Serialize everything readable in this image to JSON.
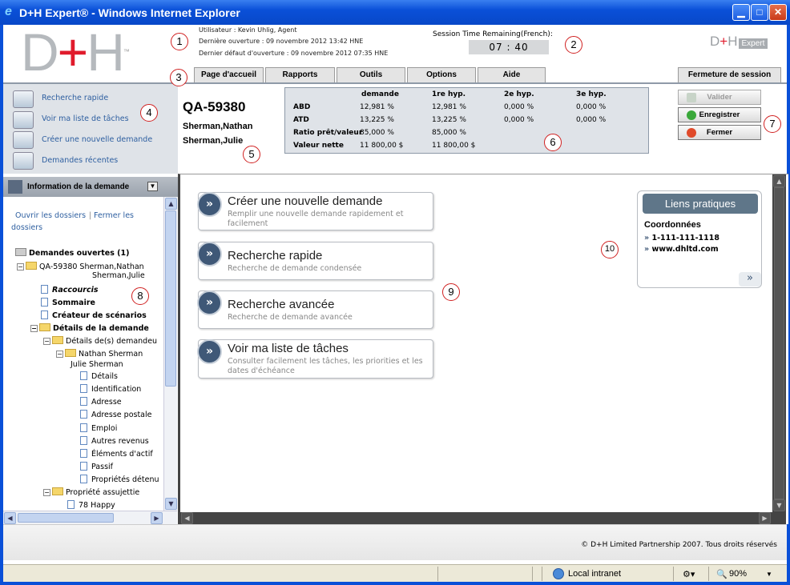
{
  "window": {
    "title": "D+H Expert® - Windows Internet Explorer"
  },
  "header": {
    "logo_d": "D",
    "logo_plus": "+",
    "logo_h": "H",
    "logo_tm": "™",
    "user_line": "Utilisateur : Kevin Uhlig, Agent",
    "last_open_line": "Dernière ouverture : 09 novembre 2012 13:42 HNE",
    "last_fail_line": "Dernier défaut d'ouverture : 09 novembre 2012 07:35 HNE",
    "session_label": "Session Time Remaining(French):",
    "session_time": "07 : 40",
    "logo2_text": "D+H",
    "logo2_badge": "Expert"
  },
  "nav": {
    "tabs": [
      "Page d'accueil",
      "Rapports",
      "Outils",
      "Options",
      "Aide"
    ],
    "logout": "Fermeture de session"
  },
  "quick_links": [
    "Recherche rapide",
    "Voir ma liste de tâches",
    "Créer une nouvelle demande",
    "Demandes récentes"
  ],
  "section_header": "Information de la demande",
  "tree": {
    "open_label": "Ouvrir les dossiers",
    "close_label": "Fermer les",
    "close_label2": "dossiers",
    "open_requests": "Demandes ouvertes (1)",
    "request_line1": "QA-59380 Sherman,Nathan",
    "request_line2": "Sherman,Julie",
    "raccourcis": "Raccourcis",
    "sommaire": "Sommaire",
    "createur": "Créateur de scénarios",
    "details_demande": "Détails de la demande",
    "details_demandeur": "Détails de(s) demandeu",
    "nathan": "Nathan Sherman",
    "julie": "Julie Sherman",
    "leaves": [
      "Détails",
      "Identification",
      "Adresse",
      "Adresse postale",
      "Emploi",
      "Autres revenus",
      "Éléments d'actif",
      "Passif",
      "Propriétés détenu"
    ],
    "propriete": "Propriété assujettie",
    "happy": "78 Happy"
  },
  "request": {
    "id": "QA-59380",
    "applicant1": "Sherman,Nathan",
    "applicant2": "Sherman,Julie"
  },
  "ratios": {
    "headers": [
      "demande",
      "1re hyp.",
      "2e hyp.",
      "3e hyp."
    ],
    "rows": [
      {
        "label": "ABD",
        "values": [
          "12,981 %",
          "12,981 %",
          "0,000 %",
          "0,000 %"
        ]
      },
      {
        "label": "ATD",
        "values": [
          "13,225 %",
          "13,225 %",
          "0,000 %",
          "0,000 %"
        ]
      },
      {
        "label": "Ratio prêt/valeur",
        "values": [
          "85,000 %",
          "85,000 %",
          "",
          ""
        ]
      },
      {
        "label": "Valeur nette",
        "values": [
          "11 800,00 $",
          "11 800,00 $",
          "",
          ""
        ]
      }
    ]
  },
  "actions": {
    "validate": "Valider",
    "save": "Enregistrer",
    "close": "Fermer"
  },
  "cards": [
    {
      "title": "Créer une nouvelle demande",
      "subtitle": "Remplir une nouvelle demande rapidement et facilement"
    },
    {
      "title": "Recherche rapide",
      "subtitle": "Recherche de demande condensée"
    },
    {
      "title": "Recherche avancée",
      "subtitle": "Recherche de demande avancée"
    },
    {
      "title": "Voir ma liste de tâches",
      "subtitle": "Consulter facilement les tâches, les priorities et les dates d'échéance"
    }
  ],
  "links_panel": {
    "title": "Liens pratiques",
    "subtitle": "Coordonnées",
    "phone": "1-111-111-1118",
    "site": "www.dhltd.com",
    "more": "»"
  },
  "callouts": [
    "1",
    "2",
    "3",
    "4",
    "5",
    "6",
    "7",
    "8",
    "9",
    "10"
  ],
  "footer": {
    "copyright": "© D+H Limited Partnership 2007. Tous droits réservés"
  },
  "statusbar": {
    "zone": "Local intranet",
    "zoom": "90%"
  }
}
